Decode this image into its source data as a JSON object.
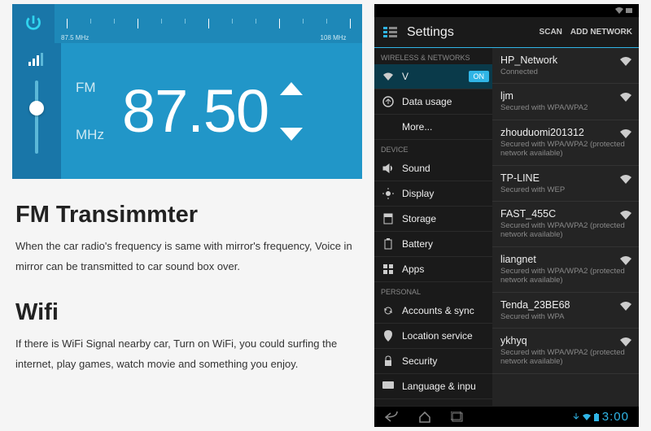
{
  "fm": {
    "freq_low": "87.5 MHz",
    "freq_high": "108 MHz",
    "band_label": "FM",
    "unit_label": "MHz",
    "frequency": "87.50"
  },
  "sections": [
    {
      "title": "FM Transimmter",
      "body": "When the car radio's frequency is same with mirror's frequency, Voice in mirror can be transmitted to car sound box over."
    },
    {
      "title": "Wifi",
      "body": "If there is WiFi Signal nearby car, Turn on WiFi, you could surfing the internet, play games, watch movie and something you enjoy."
    }
  ],
  "android": {
    "title": "Settings",
    "scan": "SCAN",
    "add": "ADD NETWORK",
    "categories": {
      "wireless": "WIRELESS & NETWORKS",
      "device": "DEVICE",
      "personal": "PERSONAL"
    },
    "toggle": "ON",
    "items": {
      "wifi": "V",
      "data": "Data usage",
      "more": "More...",
      "sound": "Sound",
      "display": "Display",
      "storage": "Storage",
      "battery": "Battery",
      "apps": "Apps",
      "accounts": "Accounts & sync",
      "location": "Location service",
      "security": "Security",
      "language": "Language & inpu"
    },
    "networks": [
      {
        "name": "HP_Network",
        "sub": "Connected"
      },
      {
        "name": "ljm",
        "sub": "Secured with WPA/WPA2"
      },
      {
        "name": "zhouduomi201312",
        "sub": "Secured with WPA/WPA2 (protected network available)"
      },
      {
        "name": "TP-LINE",
        "sub": "Secured with WEP"
      },
      {
        "name": "FAST_455C",
        "sub": "Secured with WPA/WPA2 (protected network available)"
      },
      {
        "name": "liangnet",
        "sub": "Secured with WPA/WPA2 (protected network available)"
      },
      {
        "name": "Tenda_23BE68",
        "sub": "Secured with WPA"
      },
      {
        "name": "ykhyq",
        "sub": "Secured with WPA/WPA2 (protected network available)"
      }
    ],
    "time": "3:00"
  }
}
